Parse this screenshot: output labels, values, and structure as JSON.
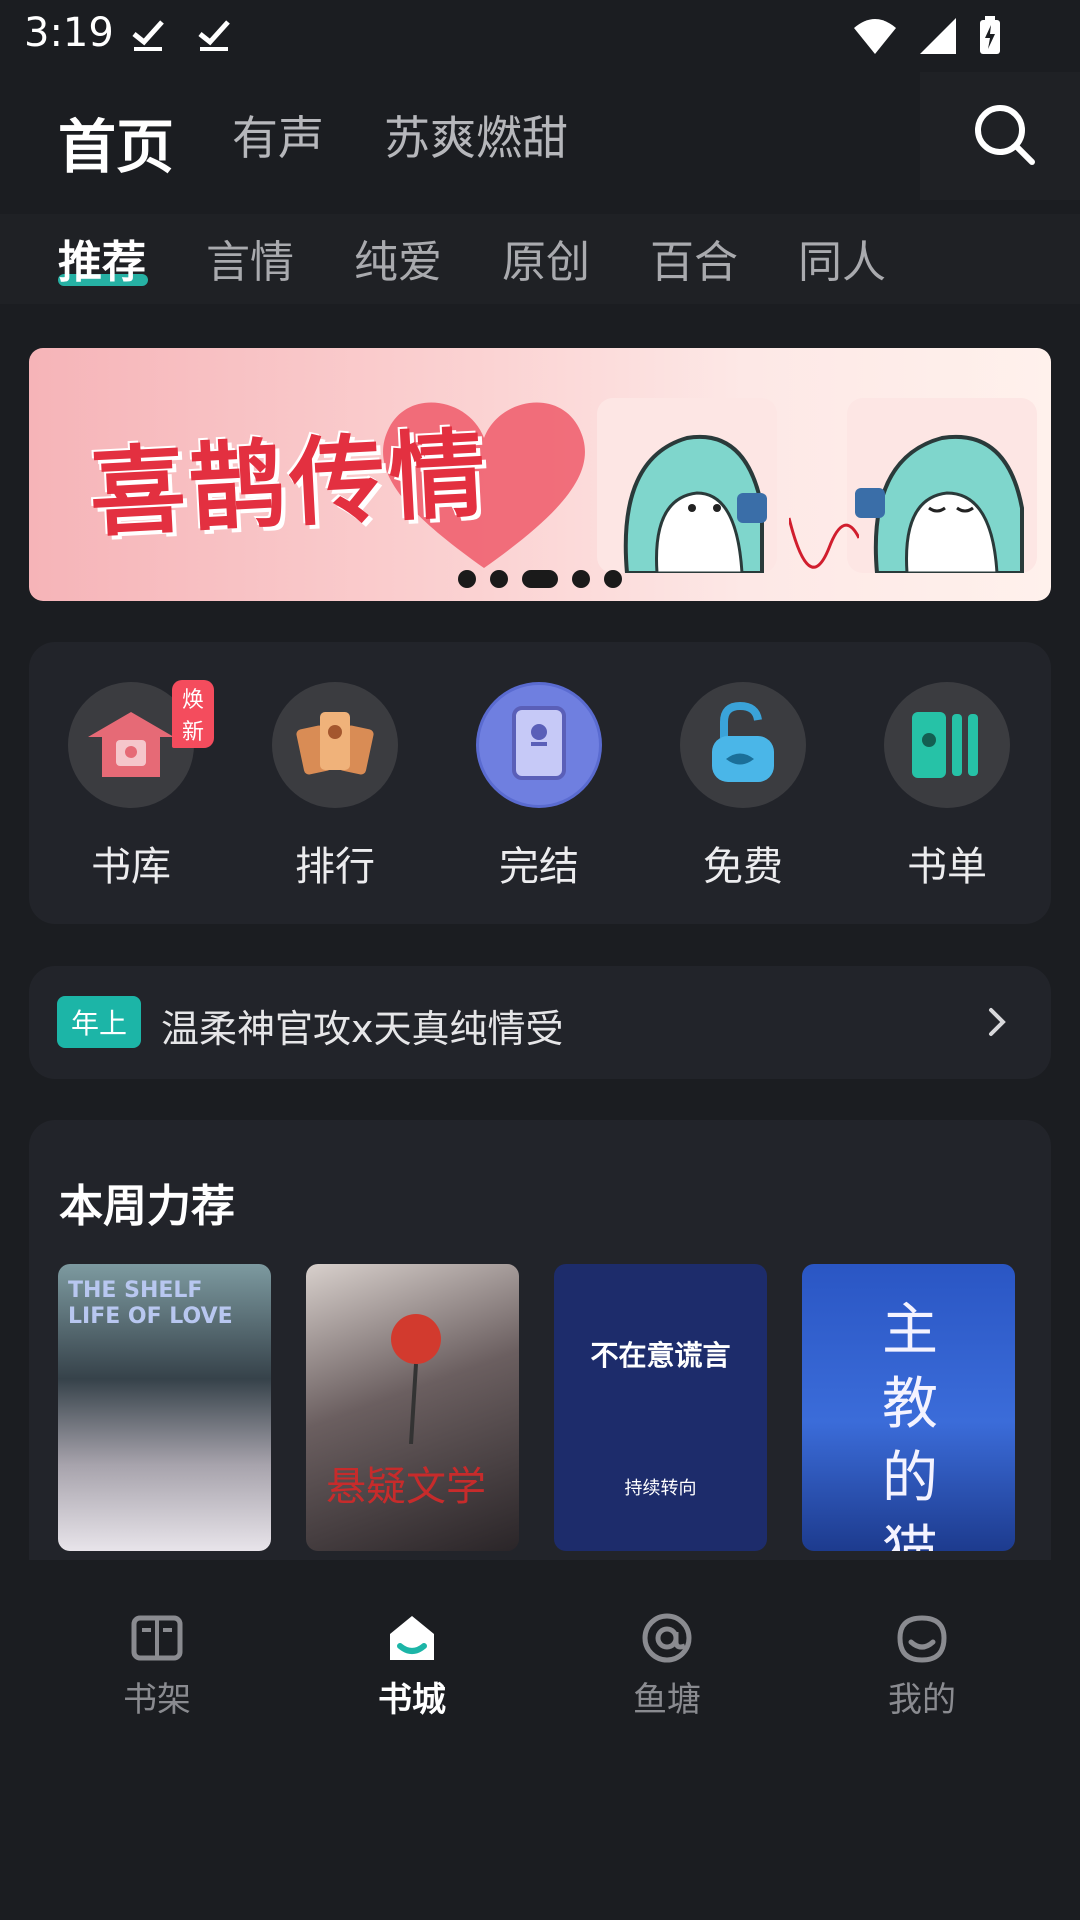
{
  "status_bar": {
    "time": "3:19",
    "icons": [
      "download-check-icon",
      "download-check-icon",
      "wifi-icon",
      "signal-icon",
      "battery-charging-icon"
    ]
  },
  "top_nav": {
    "tabs": [
      {
        "label": "首页",
        "active": true
      },
      {
        "label": "有声",
        "active": false
      },
      {
        "label": "苏爽燃甜",
        "active": false
      }
    ],
    "search_icon": "search-icon"
  },
  "category_tabs": [
    {
      "label": "推荐",
      "active": true
    },
    {
      "label": "言情",
      "active": false
    },
    {
      "label": "纯爱",
      "active": false
    },
    {
      "label": "原创",
      "active": false
    },
    {
      "label": "百合",
      "active": false
    },
    {
      "label": "同人",
      "active": false
    }
  ],
  "banner": {
    "title": "喜鹊传情",
    "slide_count": 5,
    "active_slide": 3
  },
  "entries": [
    {
      "label": "书库",
      "icon": "library-icon",
      "badge": "焕新",
      "color": "#e0626e"
    },
    {
      "label": "排行",
      "icon": "ranking-icon",
      "badge": "",
      "color": "#e8a26a"
    },
    {
      "label": "完结",
      "icon": "finished-book-icon",
      "badge": "",
      "color": "#8b7fd9"
    },
    {
      "label": "免费",
      "icon": "free-unlock-icon",
      "badge": "",
      "color": "#3aa3d9"
    },
    {
      "label": "书单",
      "icon": "booklist-icon",
      "badge": "",
      "color": "#26c2a7"
    }
  ],
  "tag_row": {
    "pill": "年上",
    "text": "温柔神官攻x天真纯情受"
  },
  "weekly": {
    "title": "本周力荐",
    "covers": [
      {
        "text": "THE SHELF LIFE OF LOVE",
        "bg": "#6d8a8f"
      },
      {
        "text": "悬疑文学",
        "bg": "#2a2528"
      },
      {
        "text": "不在意谎言",
        "sub": "持续转向",
        "bg": "#1d2c6b"
      },
      {
        "text": "主教的猫",
        "bg": "#2c4fb0"
      }
    ]
  },
  "bottom_nav": [
    {
      "label": "书架",
      "icon": "bookshelf-icon",
      "active": false
    },
    {
      "label": "书城",
      "icon": "bookstore-home-icon",
      "active": true
    },
    {
      "label": "鱼塘",
      "icon": "fishpond-at-icon",
      "active": false
    },
    {
      "label": "我的",
      "icon": "profile-icon",
      "active": false
    }
  ],
  "colors": {
    "accent": "#27c1b3",
    "background": "#1b1d21",
    "panel": "#22242a"
  }
}
